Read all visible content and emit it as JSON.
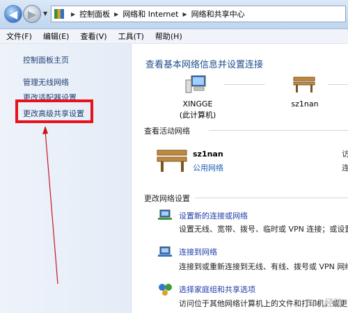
{
  "address_bar": {
    "back_icon": "arrow-left-icon",
    "forward_icon": "arrow-right-icon",
    "breadcrumbs": [
      "控制面板",
      "网络和 Internet",
      "网络和共享中心"
    ]
  },
  "menu": [
    "文件(F)",
    "编辑(E)",
    "查看(V)",
    "工具(T)",
    "帮助(H)"
  ],
  "sidebar": {
    "items": [
      {
        "label": "控制面板主页"
      },
      {
        "label": "管理无线网络"
      },
      {
        "label": "更改适配器设置"
      },
      {
        "label": "更改高级共享设置",
        "highlighted": true
      }
    ],
    "highlight_color": "#e8121c"
  },
  "main": {
    "title": "查看基本网络信息并设置连接",
    "this_pc": {
      "name": "XINGGE",
      "sub": "(此计算机)"
    },
    "network_node": "sz1nan",
    "active_section": "查看活动网络",
    "active_network": {
      "name": "sz1nan",
      "type": "公用网络",
      "trunc1": "访",
      "trunc2": "连"
    },
    "settings_section": "更改网络设置",
    "tasks": [
      {
        "link": "设置新的连接或网络",
        "desc": "设置无线、宽带、拨号、临时或 VPN 连接；或设置"
      },
      {
        "link": "连接到网络",
        "desc": "连接到或重新连接到无线、有线、拨号或 VPN 网络"
      },
      {
        "link": "选择家庭组和共享选项",
        "desc": "访问位于其他网络计算机上的文件和打印机，或更改"
      }
    ],
    "link_color": "#1f3fa8",
    "title_color": "#1e4e8c"
  },
  "watermark": "Bai 经验"
}
